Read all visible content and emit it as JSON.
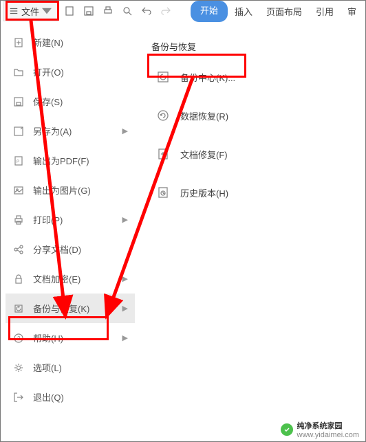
{
  "file_button": {
    "label": "文件"
  },
  "tabs": {
    "start": "开始",
    "insert": "插入",
    "layout": "页面布局",
    "reference": "引用",
    "review": "审"
  },
  "menu": {
    "new": "新建(N)",
    "open": "打开(O)",
    "save": "保存(S)",
    "saveas": "另存为(A)",
    "exportpdf": "输出为PDF(F)",
    "exportimg": "输出为图片(G)",
    "print": "打印(P)",
    "share": "分享文档(D)",
    "encrypt": "文档加密(E)",
    "backup": "备份与恢复(K)",
    "help": "帮助(H)",
    "options": "选项(L)",
    "exit": "退出(Q)"
  },
  "submenu": {
    "title": "备份与恢复",
    "backup_center": "备份中心(K)...",
    "data_recovery": "数据恢复(R)",
    "doc_repair": "文档修复(F)",
    "history": "历史版本(H)"
  },
  "watermark": {
    "brand": "纯净系统家园",
    "url": "www.yidaimei.com"
  }
}
